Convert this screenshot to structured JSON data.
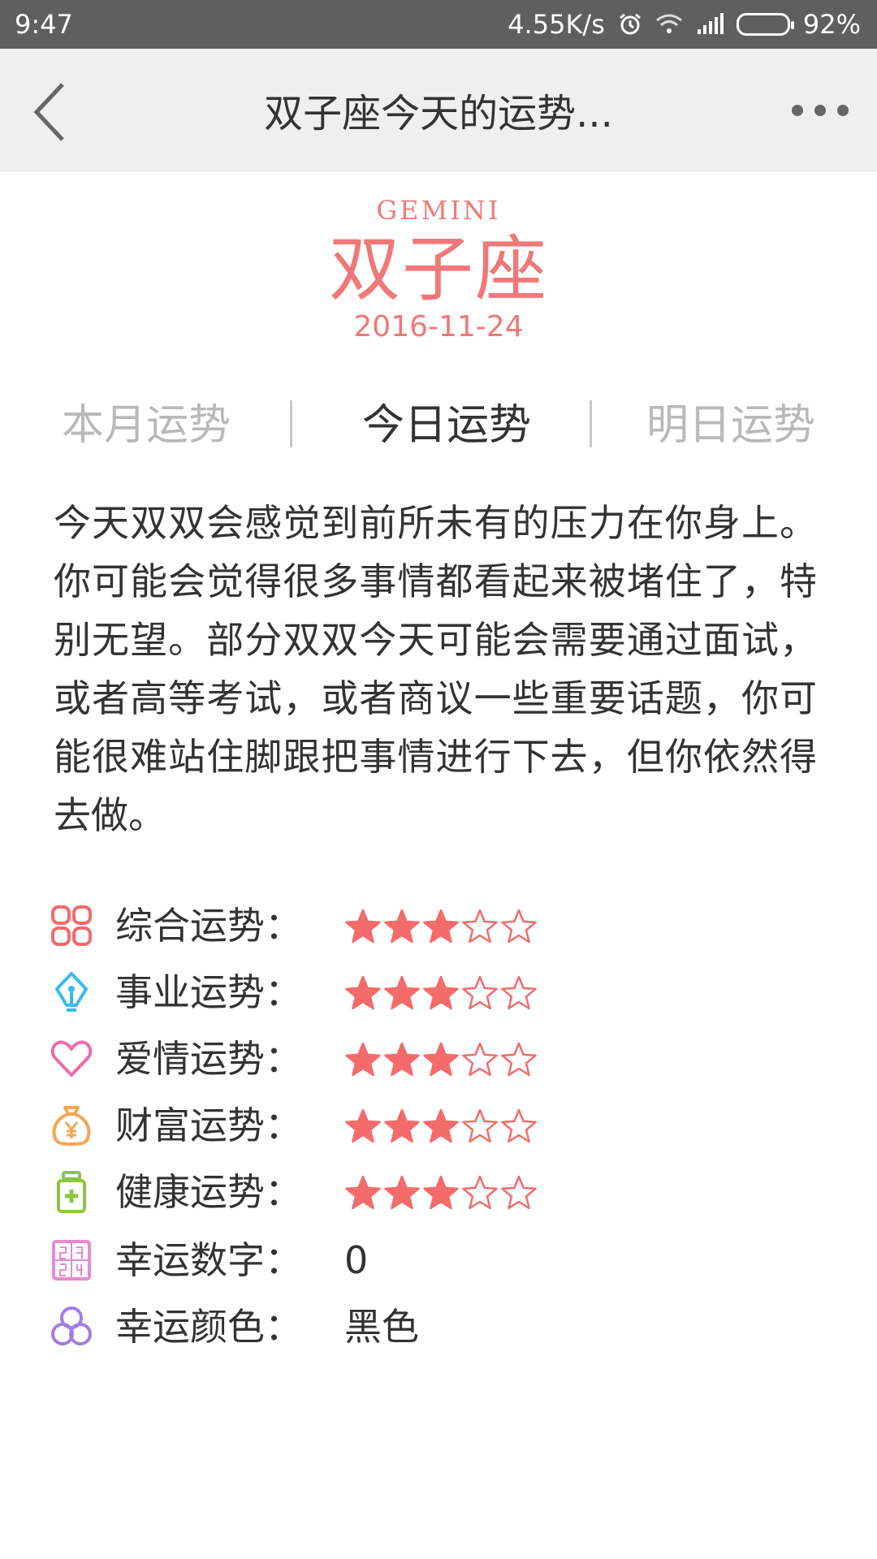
{
  "status_bar": {
    "time": "9:47",
    "net_speed": "4.55K/s",
    "battery_percent": "92%",
    "battery_level": 0.92,
    "icons": [
      "alarm-icon",
      "wifi-icon",
      "signal-icon",
      "battery-icon"
    ]
  },
  "header": {
    "title": "双子座今天的运势..."
  },
  "sign": {
    "english": "GEMINI",
    "chinese": "双子座",
    "date": "2016-11-24"
  },
  "tabs": [
    {
      "label": "本月运势",
      "active": false
    },
    {
      "label": "今日运势",
      "active": true
    },
    {
      "label": "明日运势",
      "active": false
    }
  ],
  "description": "今天双双会感觉到前所未有的压力在你身上。你可能会觉得很多事情都看起来被堵住了，特别无望。部分双双今天可能会需要通过面试，或者高等考试，或者商议一些重要话题，你可能很难站住脚跟把事情进行下去，但你依然得去做。",
  "fortunes": [
    {
      "label": "综合运势：",
      "icon": "grid-icon",
      "icon_color": "#f06b6b",
      "stars": 3,
      "max_stars": 5
    },
    {
      "label": "事业运势：",
      "icon": "pen-nib-icon",
      "icon_color": "#39b9f0",
      "stars": 3,
      "max_stars": 5
    },
    {
      "label": "爱情运势：",
      "icon": "heart-icon",
      "icon_color": "#f06aa8",
      "stars": 3,
      "max_stars": 5
    },
    {
      "label": "财富运势：",
      "icon": "money-bag-icon",
      "icon_color": "#f5a552",
      "stars": 3,
      "max_stars": 5
    },
    {
      "label": "健康运势：",
      "icon": "medicine-bottle-icon",
      "icon_color": "#8cc63f",
      "stars": 3,
      "max_stars": 5
    }
  ],
  "lucky": [
    {
      "label": "幸运数字：",
      "icon": "number-icon",
      "icon_color": "#e98ad1",
      "value": "0"
    },
    {
      "label": "幸运颜色：",
      "icon": "color-circles-icon",
      "icon_color": "#a37de0",
      "value": "黑色"
    }
  ],
  "colors": {
    "accent": "#f07878",
    "star": "#f46b6b"
  }
}
